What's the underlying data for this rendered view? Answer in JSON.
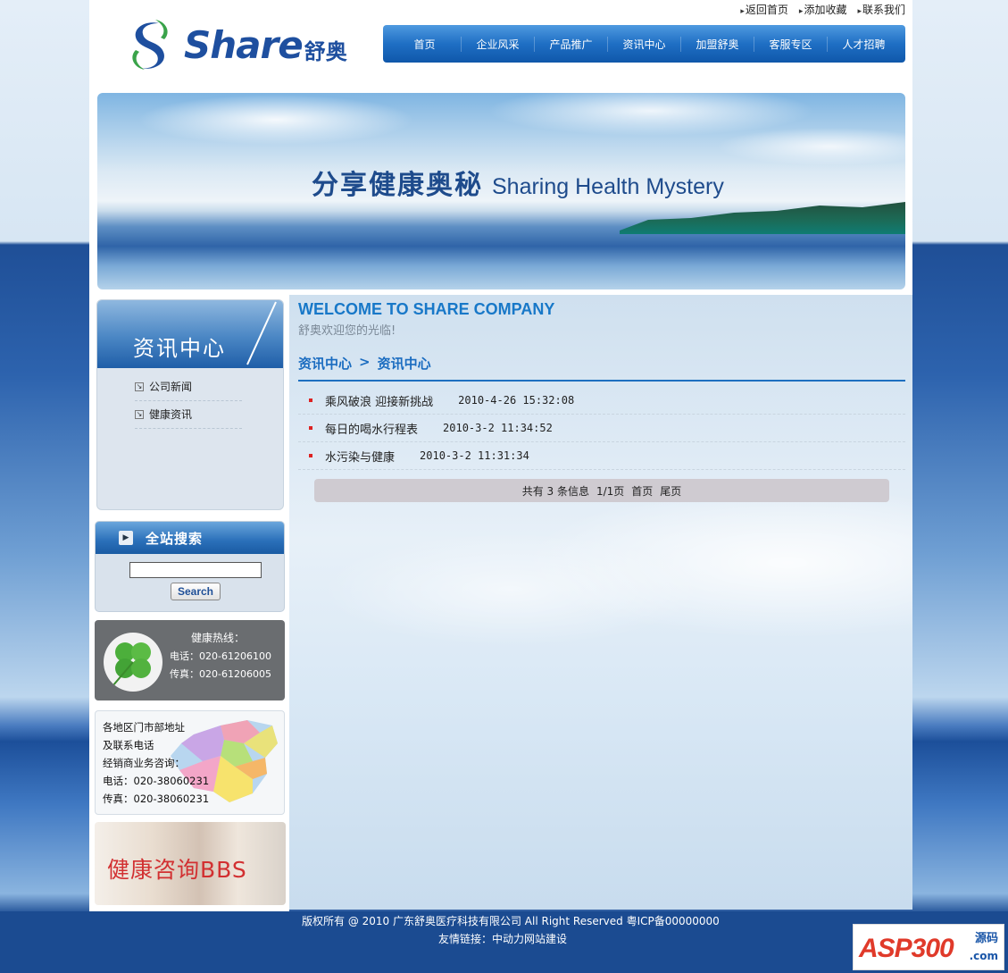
{
  "header": {
    "top_links": [
      "返回首页",
      "添加收藏",
      "联系我们"
    ],
    "logo_text": "Share",
    "logo_cn": "舒奥",
    "nav": [
      "首页",
      "企业风采",
      "产品推广",
      "资讯中心",
      "加盟舒奥",
      "客服专区",
      "人才招聘"
    ]
  },
  "banner": {
    "title_cn": "分享健康奥秘",
    "title_en": "Sharing Health Mystery"
  },
  "sidebar": {
    "news_title": "资讯中心",
    "news_items": [
      "公司新闻",
      "健康资讯"
    ],
    "search_title": "全站搜索",
    "search_value": "",
    "search_button": "Search",
    "hotline_title": "健康热线：",
    "hotline_phone": "电话：020-61206100",
    "hotline_fax": "传真：020-61206005",
    "map_lines": [
      "各地区门市部地址",
      "及联系电话",
      "经销商业务咨询：",
      "电话：020-38060231",
      "传真：020-38060231"
    ],
    "bbs_title": "健康咨询BBS"
  },
  "main": {
    "welcome_en": "WELCOME TO SHARE COMPANY",
    "welcome_cn": "舒奥欢迎您的光临!",
    "breadcrumb": [
      "资讯中心",
      ">",
      "资讯中心"
    ],
    "articles": [
      {
        "title": "乘风破浪 迎接新挑战",
        "date": "2010-4-26 15:32:08"
      },
      {
        "title": "每日的喝水行程表",
        "date": "2010-3-2 11:34:52"
      },
      {
        "title": "水污染与健康",
        "date": "2010-3-2 11:31:34"
      }
    ],
    "pager": {
      "summary": "共有 3 条信息",
      "page": "1/1页",
      "first": "首页",
      "last": "尾页"
    }
  },
  "footer": {
    "copyright": "版权所有 @ 2010 广东舒奥医疗科技有限公司 All Right Reserved 粤ICP备00000000",
    "links_label": "友情链接：",
    "links_value": "中动力网站建设"
  },
  "watermark": {
    "text": "ASP300",
    "cn": "源码",
    "com": ".com"
  }
}
